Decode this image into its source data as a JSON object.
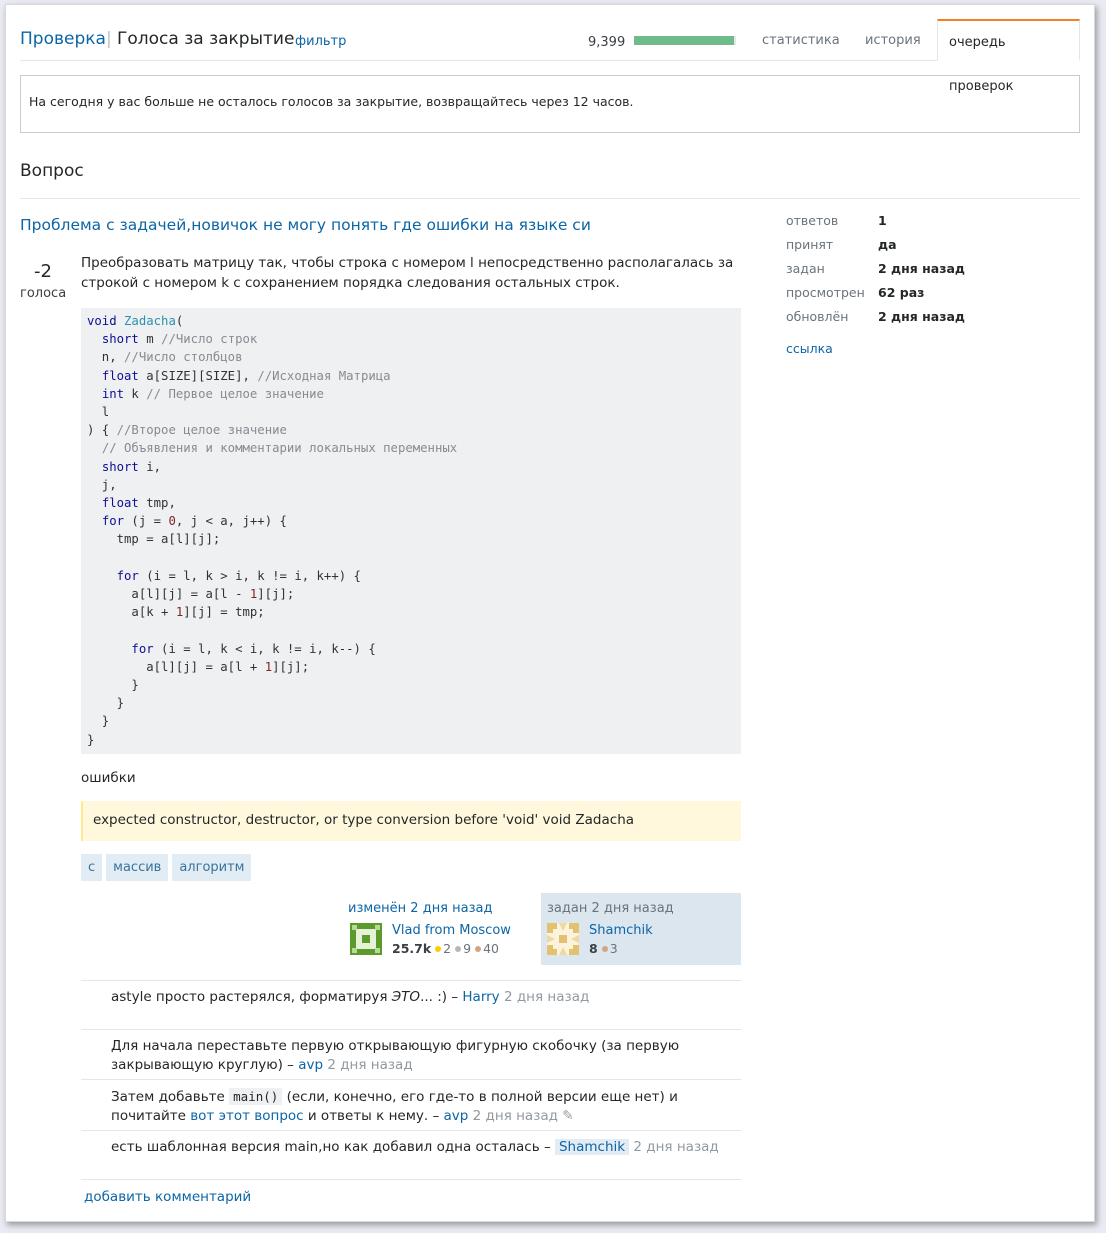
{
  "header": {
    "breadcrumb_link": "Проверка",
    "separator": "|",
    "title": "Голоса за закрытие",
    "filter": "фильтр",
    "count": "9,399",
    "progress": 0.98,
    "tabs": [
      "статистика",
      "история",
      "очередь проверок"
    ]
  },
  "notice": "На сегодня у вас больше не осталось голосов за закрытие, возвращайтесь через 12 часов.",
  "section_title": "Вопрос",
  "question": {
    "title": "Проблема с задачей,новичок не могу понять где ошибки на языке си",
    "votes": "-2",
    "votes_label": "голоса",
    "body": "Преобразовать матрицу так, чтобы строка с номером l непосредственно располагалась за строкой с номером k с сохранением порядка следования остальных строк.",
    "errors_label": "ошибки",
    "error_quote": "expected constructor, destructor, or type conversion before 'void' void Zadacha",
    "tags": [
      "c",
      "массив",
      "алгоритм"
    ],
    "editor": {
      "when": "изменён 2 дня назад",
      "name": "Vlad from Moscow",
      "rep": "25.7k",
      "gold": "2",
      "silver": "9",
      "bronze": "40"
    },
    "asker": {
      "when": "задан 2 дня назад",
      "name": "Shamchik",
      "rep": "8",
      "bronze": "3"
    }
  },
  "comments": [
    {
      "text": "astyle просто растерялся, форматируя ",
      "em": "ЭТО",
      "text2": "... :) – ",
      "user": "Harry",
      "date": "2 дня назад"
    },
    {
      "text": "Для начала переставьте первую открывающую фигурную скобочку (за первую закрывающую круглую) – ",
      "user": "avp",
      "date": "2 дня назад"
    },
    {
      "text": "Затем добавьте ",
      "code": "main()",
      "text2": " (если, конечно, его где-то в полной версии еще нет) и почитайте ",
      "link": "вот этот вопрос",
      "text3": " и ответы к нему. – ",
      "user": "avp",
      "date": "2 дня назад"
    },
    {
      "text": "есть шаблонная версия main,но как добавил одна осталась – ",
      "user": "Shamchik",
      "date": "2 дня назад"
    }
  ],
  "add_comment": "добавить комментарий",
  "stats": [
    {
      "k": "ответов",
      "v": "1"
    },
    {
      "k": "принят",
      "v": "да"
    },
    {
      "k": "задан",
      "v": "2 дня назад"
    },
    {
      "k": "просмотрен",
      "v": "62 раз"
    },
    {
      "k": "обновлён",
      "v": "2 дня назад"
    }
  ],
  "stats_link": "ссылка"
}
